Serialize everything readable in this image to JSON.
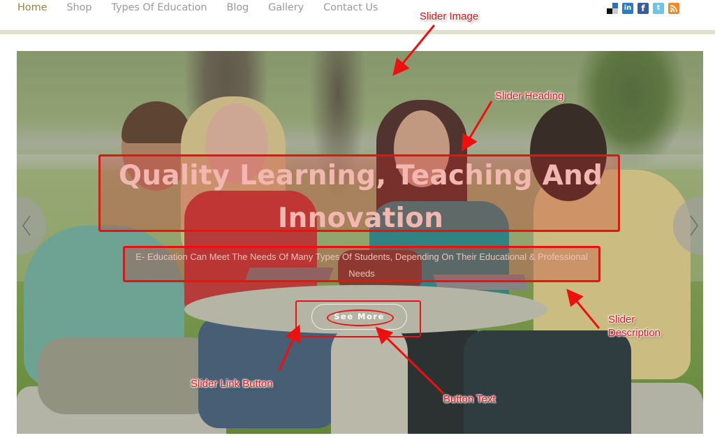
{
  "nav": {
    "items": [
      {
        "label": "Home",
        "active": true
      },
      {
        "label": "Shop",
        "active": false
      },
      {
        "label": "Types Of Education",
        "active": false
      },
      {
        "label": "Blog",
        "active": false
      },
      {
        "label": "Gallery",
        "active": false
      },
      {
        "label": "Contact Us",
        "active": false
      }
    ],
    "active_color": "#8f8a3f",
    "inactive_color": "#9b9b9b"
  },
  "social": {
    "icons": [
      "delicious-icon",
      "linkedin-icon",
      "facebook-icon",
      "twitter-icon",
      "rss-icon"
    ],
    "linkedin_glyph": "in",
    "facebook_glyph": "f",
    "twitter_glyph": "t"
  },
  "slider": {
    "heading": "Quality Learning, Teaching And Innovation",
    "description": "E- Education Can Meet The Needs Of Many Types Of Students, Depending On Their Educational & Professional Needs",
    "button_label": "See More",
    "prev_icon": "chevron-left-icon",
    "next_icon": "chevron-right-icon"
  },
  "annotations": {
    "slider_image": "Slider Image",
    "slider_heading": "Slider Heading",
    "slider_description": "Slider Description",
    "slider_link_button": "Slider Link Button",
    "button_text": "Button Text",
    "color": "#ee0f0f"
  }
}
